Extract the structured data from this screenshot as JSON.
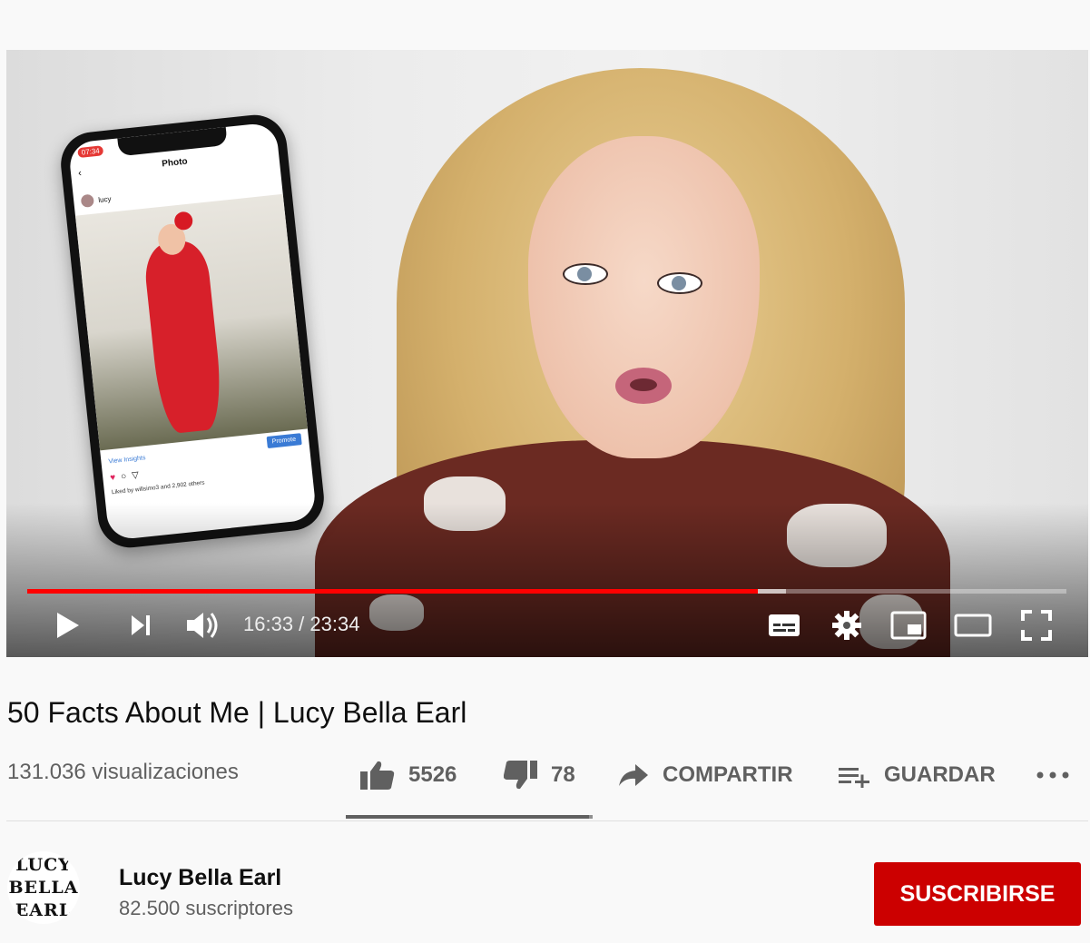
{
  "player": {
    "current_time": "16:33",
    "duration": "23:34",
    "time_display": "16:33 / 23:34",
    "progress_played": 0.703,
    "progress_loaded": 0.73,
    "accent_color": "#ff0000",
    "phone_overlay": {
      "status_time": "07:34",
      "header": "Photo",
      "username": "lucy",
      "view_insights": "View Insights",
      "promote": "Promote",
      "liked_by": "Liked by willsimo3 and 2,902 others"
    }
  },
  "video": {
    "title": "50 Facts About Me | Lucy Bella Earl",
    "views": "131.036 visualizaciones"
  },
  "actions": {
    "likes": "5526",
    "dislikes": "78",
    "share_label": "COMPARTIR",
    "save_label": "GUARDAR",
    "like_ratio": 0.986
  },
  "channel": {
    "name": "Lucy Bella Earl",
    "subscribers": "82.500 suscriptores",
    "avatar_lines": [
      "LUCY",
      "BELLA",
      "EARL"
    ],
    "subscribe_label": "SUSCRIBIRSE",
    "subscribe_color": "#cc0000"
  }
}
